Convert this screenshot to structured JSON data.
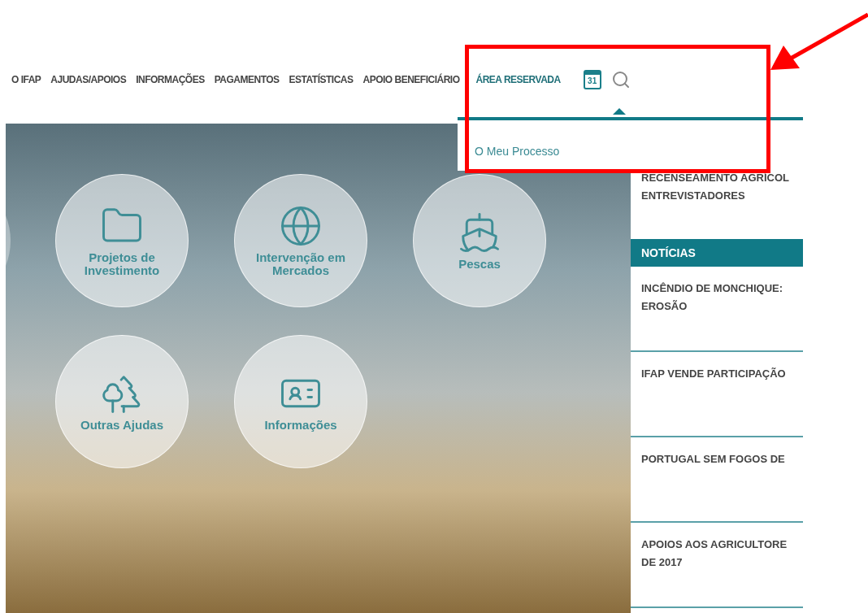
{
  "nav": [
    {
      "label": "O IFAP",
      "selected": false
    },
    {
      "label": "AJUDAS/APOIOS",
      "selected": false
    },
    {
      "label": "INFORMAÇÕES",
      "selected": false
    },
    {
      "label": "PAGAMENTOS",
      "selected": false
    },
    {
      "label": "ESTATÍSTICAS",
      "selected": false
    },
    {
      "label": "APOIO BENEFICIÁRIO",
      "selected": false
    },
    {
      "label": "ÁREA RESERVADA",
      "selected": true
    }
  ],
  "calendar_day": "31",
  "dropdown": {
    "items": [
      "O Meu Processo"
    ]
  },
  "tiles": [
    {
      "kind": "folder",
      "label": "Projetos de Investimento"
    },
    {
      "kind": "globe",
      "label": "Intervenção em Mercados"
    },
    {
      "kind": "ship",
      "label": "Pescas"
    },
    {
      "kind": "trees",
      "label": "Outras Ajudas"
    },
    {
      "kind": "card",
      "label": "Informações"
    }
  ],
  "sidebar": {
    "top_item": [
      "RECENSEAMENTO AGRÍCOL",
      "ENTREVISTADORES"
    ],
    "news_header": "NOTÍCIAS",
    "news": [
      [
        "INCÊNDIO DE MONCHIQUE:",
        "EROSÃO"
      ],
      [
        "IFAP VENDE PARTICIPAÇÃO"
      ],
      [
        "PORTUGAL SEM FOGOS DE"
      ],
      [
        "APOIOS AOS AGRICULTORE",
        "DE 2017"
      ]
    ]
  }
}
